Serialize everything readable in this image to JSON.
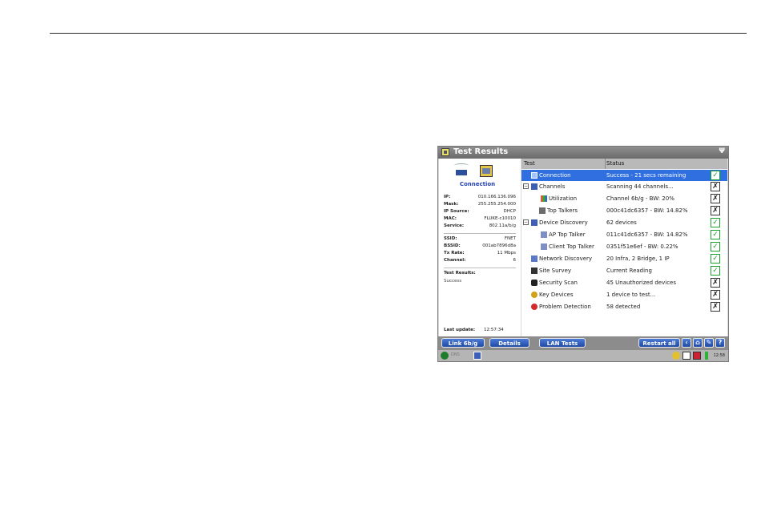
{
  "window": {
    "title": "Test Results",
    "wifi_glyph": "Ψ"
  },
  "left_panel": {
    "connection_label": "Connection",
    "info": [
      {
        "key": "IP:",
        "value": "010.166.136.096"
      },
      {
        "key": "Mask:",
        "value": "255.255.254.000"
      },
      {
        "key": "IP Source:",
        "value": "DHCP"
      },
      {
        "key": "MAC:",
        "value": "FLUKE-c10010"
      },
      {
        "key": "Service:",
        "value": "802.11a/b/g"
      }
    ],
    "info2": [
      {
        "key": "SSID:",
        "value": "FNET"
      },
      {
        "key": "BSSID:",
        "value": "001ab7896d8a"
      },
      {
        "key": "Tx Rate:",
        "value": "11 Mbps"
      },
      {
        "key": "Channel:",
        "value": "6"
      }
    ],
    "test_results_label": "Test Results:",
    "test_results_value": "Success",
    "last_update_label": "Last update:",
    "last_update_value": "12:57:34"
  },
  "table": {
    "col_test": "Test",
    "col_status": "Status",
    "rows": [
      {
        "name": "Connection",
        "status": "Success - 21 secs remaining",
        "state": "ok"
      },
      {
        "name": "Channels",
        "status": "Scanning 44 channels...",
        "state": "run"
      },
      {
        "name": "Utilization",
        "status": "Channel 6b/g - BW: 20%",
        "state": "run"
      },
      {
        "name": "Top Talkers",
        "status": "000c41dc6357 - BW: 14.82%",
        "state": "run"
      },
      {
        "name": "Device Discovery",
        "status": "62 devices",
        "state": "ok"
      },
      {
        "name": "AP Top Talker",
        "status": "011c41dc6357 - BW: 14.82%",
        "state": "ok"
      },
      {
        "name": "Client Top Talker",
        "status": "0351f51e6ef - BW: 0.22%",
        "state": "ok"
      },
      {
        "name": "Network Discovery",
        "status": "20 Infra, 2 Bridge, 1 IP",
        "state": "ok"
      },
      {
        "name": "Site Survey",
        "status": "Current Reading",
        "state": "ok"
      },
      {
        "name": "Security Scan",
        "status": "45 Unauthorized devices",
        "state": "run"
      },
      {
        "name": "Key Devices",
        "status": "1 device to test...",
        "state": "run"
      },
      {
        "name": "Problem Detection",
        "status": "58 detected",
        "state": "run"
      }
    ]
  },
  "buttons": {
    "link": "Link 6b/g",
    "details": "Details",
    "lan_tests": "LAN Tests",
    "restart_all": "Restart all",
    "help": "?"
  },
  "statusbar": {
    "label": "DNS",
    "time": "12:58"
  },
  "colors": {
    "selection": "#2f6fe0",
    "button": "#1f4aa5",
    "ok": "#16a52a"
  },
  "icons": [
    "app-icon",
    "wifi-icon",
    "access-point-icon",
    "tester-icon",
    "check-icon",
    "running-icon",
    "back-icon",
    "home-icon",
    "tools-icon",
    "help-icon"
  ]
}
